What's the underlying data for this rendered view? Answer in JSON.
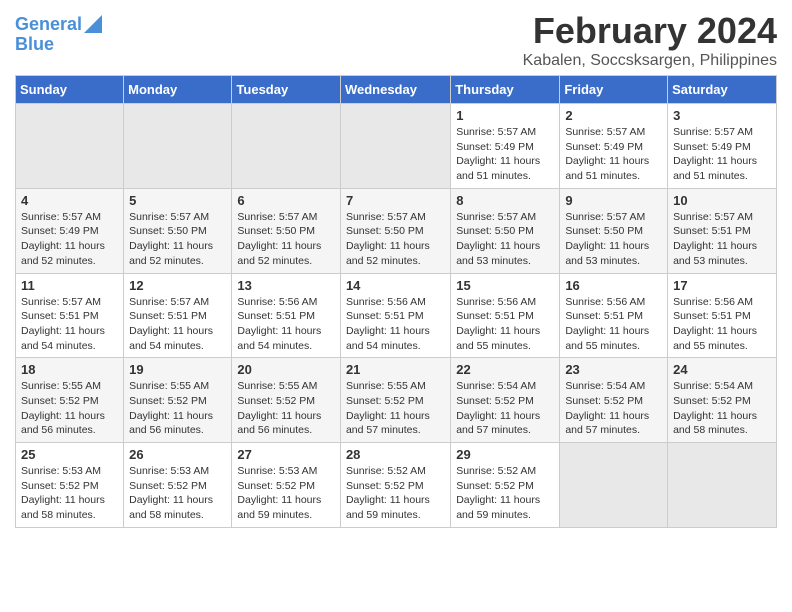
{
  "logo": {
    "line1": "General",
    "line2": "Blue"
  },
  "title": "February 2024",
  "subtitle": "Kabalen, Soccsksargen, Philippines",
  "headers": [
    "Sunday",
    "Monday",
    "Tuesday",
    "Wednesday",
    "Thursday",
    "Friday",
    "Saturday"
  ],
  "weeks": [
    [
      {
        "num": "",
        "detail": ""
      },
      {
        "num": "",
        "detail": ""
      },
      {
        "num": "",
        "detail": ""
      },
      {
        "num": "",
        "detail": ""
      },
      {
        "num": "1",
        "detail": "Sunrise: 5:57 AM\nSunset: 5:49 PM\nDaylight: 11 hours\nand 51 minutes."
      },
      {
        "num": "2",
        "detail": "Sunrise: 5:57 AM\nSunset: 5:49 PM\nDaylight: 11 hours\nand 51 minutes."
      },
      {
        "num": "3",
        "detail": "Sunrise: 5:57 AM\nSunset: 5:49 PM\nDaylight: 11 hours\nand 51 minutes."
      }
    ],
    [
      {
        "num": "4",
        "detail": "Sunrise: 5:57 AM\nSunset: 5:49 PM\nDaylight: 11 hours\nand 52 minutes."
      },
      {
        "num": "5",
        "detail": "Sunrise: 5:57 AM\nSunset: 5:50 PM\nDaylight: 11 hours\nand 52 minutes."
      },
      {
        "num": "6",
        "detail": "Sunrise: 5:57 AM\nSunset: 5:50 PM\nDaylight: 11 hours\nand 52 minutes."
      },
      {
        "num": "7",
        "detail": "Sunrise: 5:57 AM\nSunset: 5:50 PM\nDaylight: 11 hours\nand 52 minutes."
      },
      {
        "num": "8",
        "detail": "Sunrise: 5:57 AM\nSunset: 5:50 PM\nDaylight: 11 hours\nand 53 minutes."
      },
      {
        "num": "9",
        "detail": "Sunrise: 5:57 AM\nSunset: 5:50 PM\nDaylight: 11 hours\nand 53 minutes."
      },
      {
        "num": "10",
        "detail": "Sunrise: 5:57 AM\nSunset: 5:51 PM\nDaylight: 11 hours\nand 53 minutes."
      }
    ],
    [
      {
        "num": "11",
        "detail": "Sunrise: 5:57 AM\nSunset: 5:51 PM\nDaylight: 11 hours\nand 54 minutes."
      },
      {
        "num": "12",
        "detail": "Sunrise: 5:57 AM\nSunset: 5:51 PM\nDaylight: 11 hours\nand 54 minutes."
      },
      {
        "num": "13",
        "detail": "Sunrise: 5:56 AM\nSunset: 5:51 PM\nDaylight: 11 hours\nand 54 minutes."
      },
      {
        "num": "14",
        "detail": "Sunrise: 5:56 AM\nSunset: 5:51 PM\nDaylight: 11 hours\nand 54 minutes."
      },
      {
        "num": "15",
        "detail": "Sunrise: 5:56 AM\nSunset: 5:51 PM\nDaylight: 11 hours\nand 55 minutes."
      },
      {
        "num": "16",
        "detail": "Sunrise: 5:56 AM\nSunset: 5:51 PM\nDaylight: 11 hours\nand 55 minutes."
      },
      {
        "num": "17",
        "detail": "Sunrise: 5:56 AM\nSunset: 5:51 PM\nDaylight: 11 hours\nand 55 minutes."
      }
    ],
    [
      {
        "num": "18",
        "detail": "Sunrise: 5:55 AM\nSunset: 5:52 PM\nDaylight: 11 hours\nand 56 minutes."
      },
      {
        "num": "19",
        "detail": "Sunrise: 5:55 AM\nSunset: 5:52 PM\nDaylight: 11 hours\nand 56 minutes."
      },
      {
        "num": "20",
        "detail": "Sunrise: 5:55 AM\nSunset: 5:52 PM\nDaylight: 11 hours\nand 56 minutes."
      },
      {
        "num": "21",
        "detail": "Sunrise: 5:55 AM\nSunset: 5:52 PM\nDaylight: 11 hours\nand 57 minutes."
      },
      {
        "num": "22",
        "detail": "Sunrise: 5:54 AM\nSunset: 5:52 PM\nDaylight: 11 hours\nand 57 minutes."
      },
      {
        "num": "23",
        "detail": "Sunrise: 5:54 AM\nSunset: 5:52 PM\nDaylight: 11 hours\nand 57 minutes."
      },
      {
        "num": "24",
        "detail": "Sunrise: 5:54 AM\nSunset: 5:52 PM\nDaylight: 11 hours\nand 58 minutes."
      }
    ],
    [
      {
        "num": "25",
        "detail": "Sunrise: 5:53 AM\nSunset: 5:52 PM\nDaylight: 11 hours\nand 58 minutes."
      },
      {
        "num": "26",
        "detail": "Sunrise: 5:53 AM\nSunset: 5:52 PM\nDaylight: 11 hours\nand 58 minutes."
      },
      {
        "num": "27",
        "detail": "Sunrise: 5:53 AM\nSunset: 5:52 PM\nDaylight: 11 hours\nand 59 minutes."
      },
      {
        "num": "28",
        "detail": "Sunrise: 5:52 AM\nSunset: 5:52 PM\nDaylight: 11 hours\nand 59 minutes."
      },
      {
        "num": "29",
        "detail": "Sunrise: 5:52 AM\nSunset: 5:52 PM\nDaylight: 11 hours\nand 59 minutes."
      },
      {
        "num": "",
        "detail": ""
      },
      {
        "num": "",
        "detail": ""
      }
    ]
  ]
}
